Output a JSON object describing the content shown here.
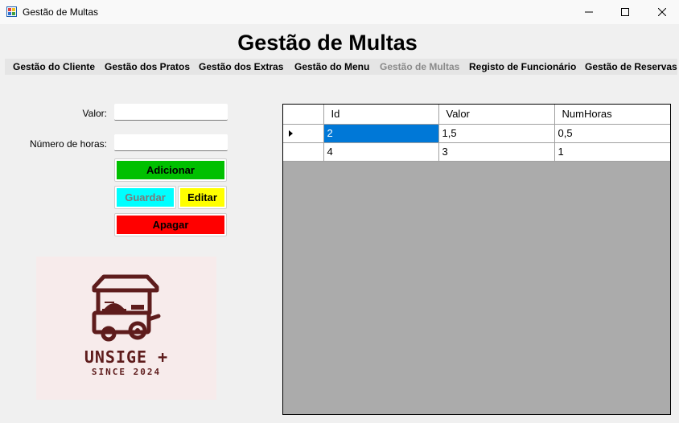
{
  "window": {
    "title": "Gestão de Multas"
  },
  "form": {
    "title": "Gestão de Multas"
  },
  "menu": {
    "items": [
      {
        "label": "Gestão do Cliente",
        "enabled": true
      },
      {
        "label": "Gestão dos Pratos",
        "enabled": true
      },
      {
        "label": "Gestão dos Extras",
        "enabled": true
      },
      {
        "label": "Gestão do Menu",
        "enabled": true
      },
      {
        "label": "Gestão de Multas",
        "enabled": false
      },
      {
        "label": "Registo de Funcionário",
        "enabled": true
      },
      {
        "label": "Gestão de Reservas",
        "enabled": true
      }
    ]
  },
  "fields": {
    "valor": {
      "label": "Valor:",
      "value": ""
    },
    "horas": {
      "label": "Número de horas:",
      "value": ""
    }
  },
  "buttons": {
    "adicionar": {
      "label": "Adicionar",
      "color": "#00c000"
    },
    "guardar": {
      "label": "Guardar",
      "color": "#00ffff",
      "enabled": false
    },
    "editar": {
      "label": "Editar",
      "color": "#ffff00"
    },
    "apagar": {
      "label": "Apagar",
      "color": "#ff0000"
    }
  },
  "logo": {
    "line1": "UNSIGE +",
    "line2": "SINCE 2024",
    "color": "#5e1c1c"
  },
  "grid": {
    "columns": [
      "Id",
      "Valor",
      "NumHoras"
    ],
    "rows": [
      [
        "2",
        "1,5",
        "0,5"
      ],
      [
        "4",
        "3",
        "1"
      ]
    ],
    "selected_row": 0,
    "selection_color": "#0078d7"
  }
}
